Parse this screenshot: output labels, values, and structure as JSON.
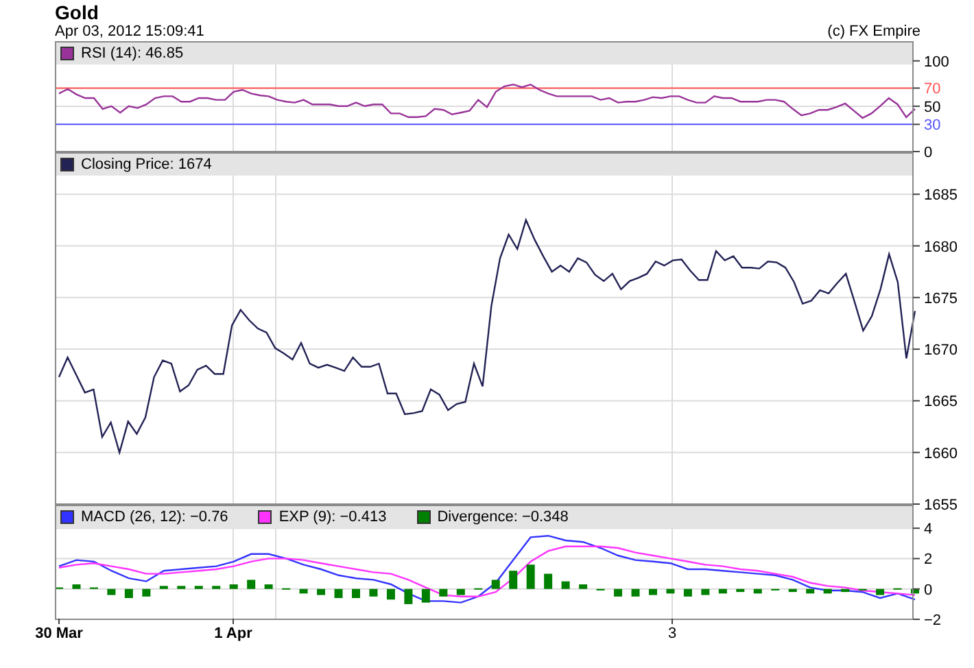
{
  "title": "Gold",
  "timestamp": "Apr 03, 2012 15:09:41",
  "copyright": "(c) FX Empire",
  "panels": [
    {
      "chart_data": {
        "type": "line",
        "legend": true,
        "ylim": [
          0,
          121
        ],
        "yticks": [
          0,
          30,
          50,
          70,
          100
        ],
        "grid": true,
        "series": [
          {
            "name": "RSI (14): 46.85",
            "color": "#993399",
            "values": [
              64,
              69,
              63,
              59,
              59,
              47,
              50,
              43,
              50,
              48,
              52,
              59,
              61,
              61,
              55,
              55,
              59,
              59,
              57,
              57,
              66,
              68,
              64,
              62,
              61,
              57,
              55,
              54,
              57,
              52,
              52,
              52,
              50,
              50,
              54,
              50,
              52,
              52,
              42,
              42,
              38,
              38,
              39,
              47,
              46,
              41,
              43,
              45,
              57,
              49,
              66,
              72,
              74,
              71,
              74,
              68,
              64,
              61,
              61,
              61,
              61,
              61,
              57,
              59,
              54,
              55,
              55,
              57,
              60,
              59,
              61,
              61,
              57,
              54,
              54,
              61,
              59,
              59,
              55,
              55,
              55,
              57,
              57,
              55,
              47,
              40,
              42,
              46,
              46,
              49,
              53,
              45,
              37,
              42,
              50,
              59,
              52,
              38,
              47
            ]
          }
        ],
        "ref_lines": [
          {
            "axis": "y",
            "value": 70,
            "color": "#ff5555"
          },
          {
            "axis": "y",
            "value": 30,
            "color": "#5555ff"
          }
        ]
      }
    },
    {
      "chart_data": {
        "type": "line",
        "legend": true,
        "ylim": [
          1655,
          1689
        ],
        "yticks": [
          1655,
          1660,
          1665,
          1670,
          1675,
          1680,
          1685
        ],
        "grid": true,
        "series": [
          {
            "name": "Closing Price: 1674",
            "color": "#222255",
            "values": [
              1667.3,
              1669.2,
              1667.5,
              1665.8,
              1666.1,
              1661.5,
              1662.9,
              1660.0,
              1663.0,
              1661.8,
              1663.4,
              1667.3,
              1668.9,
              1668.6,
              1665.9,
              1666.5,
              1668.0,
              1668.4,
              1667.6,
              1667.6,
              1672.3,
              1673.8,
              1672.8,
              1672.0,
              1671.6,
              1670.1,
              1669.6,
              1669.0,
              1670.6,
              1668.6,
              1668.2,
              1668.5,
              1668.2,
              1667.9,
              1669.2,
              1668.3,
              1668.3,
              1668.6,
              1665.7,
              1665.7,
              1663.7,
              1663.8,
              1664.0,
              1666.1,
              1665.6,
              1664.1,
              1664.7,
              1664.9,
              1668.6,
              1666.4,
              1674.2,
              1678.8,
              1681.1,
              1679.7,
              1682.5,
              1680.6,
              1679.0,
              1677.5,
              1678.1,
              1677.5,
              1678.8,
              1678.4,
              1677.2,
              1676.6,
              1677.3,
              1675.8,
              1676.6,
              1676.9,
              1677.3,
              1678.5,
              1678.1,
              1678.6,
              1678.7,
              1677.6,
              1676.7,
              1676.7,
              1679.5,
              1678.6,
              1679.0,
              1677.9,
              1677.9,
              1677.8,
              1678.5,
              1678.4,
              1677.9,
              1676.5,
              1674.4,
              1674.7,
              1675.7,
              1675.4,
              1676.4,
              1677.3,
              1674.6,
              1671.8,
              1673.2,
              1675.8,
              1679.2,
              1676.5,
              1669.1,
              1673.7
            ]
          }
        ]
      }
    },
    {
      "chart_data": {
        "type": "line",
        "legend": true,
        "ylim": [
          -2,
          5.5
        ],
        "yticks": [
          {
            "value": -2,
            "label": "−2"
          },
          {
            "value": 0,
            "label": "0"
          },
          {
            "value": 2,
            "label": "2"
          },
          {
            "value": 4,
            "label": "4"
          }
        ],
        "grid": true,
        "series": [
          {
            "name": "MACD (26, 12): −0.76",
            "color": "#3333ff",
            "values": [
              1.5,
              1.9,
              1.8,
              1.2,
              0.7,
              0.5,
              1.2,
              1.3,
              1.4,
              1.5,
              1.8,
              2.3,
              2.3,
              2.0,
              1.6,
              1.3,
              0.9,
              0.7,
              0.6,
              0.3,
              -0.3,
              -0.8,
              -0.8,
              -0.9,
              -0.5,
              0.4,
              1.9,
              3.4,
              3.5,
              3.2,
              3.1,
              2.7,
              2.2,
              1.9,
              1.8,
              1.7,
              1.3,
              1.3,
              1.2,
              1.1,
              1.0,
              0.9,
              0.6,
              0.1,
              -0.1,
              -0.1,
              -0.2,
              -0.6,
              -0.3,
              -0.7
            ]
          },
          {
            "name": "EXP (9): −0.413",
            "color": "#ff33ff",
            "values": [
              1.4,
              1.6,
              1.7,
              1.5,
              1.3,
              1.0,
              1.0,
              1.1,
              1.2,
              1.3,
              1.5,
              1.8,
              2.0,
              2.0,
              1.9,
              1.7,
              1.5,
              1.3,
              1.1,
              1.0,
              0.6,
              0.1,
              -0.4,
              -0.5,
              -0.5,
              -0.2,
              0.7,
              1.8,
              2.5,
              2.8,
              2.8,
              2.8,
              2.7,
              2.4,
              2.2,
              2.0,
              1.8,
              1.6,
              1.5,
              1.3,
              1.2,
              1.0,
              0.8,
              0.4,
              0.2,
              0.1,
              -0.1,
              -0.2,
              -0.3,
              -0.4
            ]
          },
          {
            "name": "Divergence: −0.348",
            "color": "#008000",
            "type": "bar",
            "values": [
              0.1,
              0.3,
              0.1,
              -0.4,
              -0.6,
              -0.5,
              0.2,
              0.2,
              0.2,
              0.2,
              0.3,
              0.6,
              0.3,
              0,
              -0.3,
              -0.4,
              -0.6,
              -0.6,
              -0.5,
              -0.7,
              -1.0,
              -0.9,
              -0.5,
              -0.4,
              0,
              0.6,
              1.2,
              1.6,
              1.0,
              0.5,
              0.3,
              -0.1,
              -0.5,
              -0.5,
              -0.4,
              -0.3,
              -0.5,
              -0.4,
              -0.3,
              -0.2,
              -0.3,
              -0.1,
              -0.2,
              -0.3,
              -0.3,
              -0.2,
              -0.1,
              -0.4,
              0,
              -0.3
            ]
          }
        ]
      },
      "x_labels": [
        "**30 Mar**",
        "**1 Apr**",
        "3"
      ]
    }
  ]
}
